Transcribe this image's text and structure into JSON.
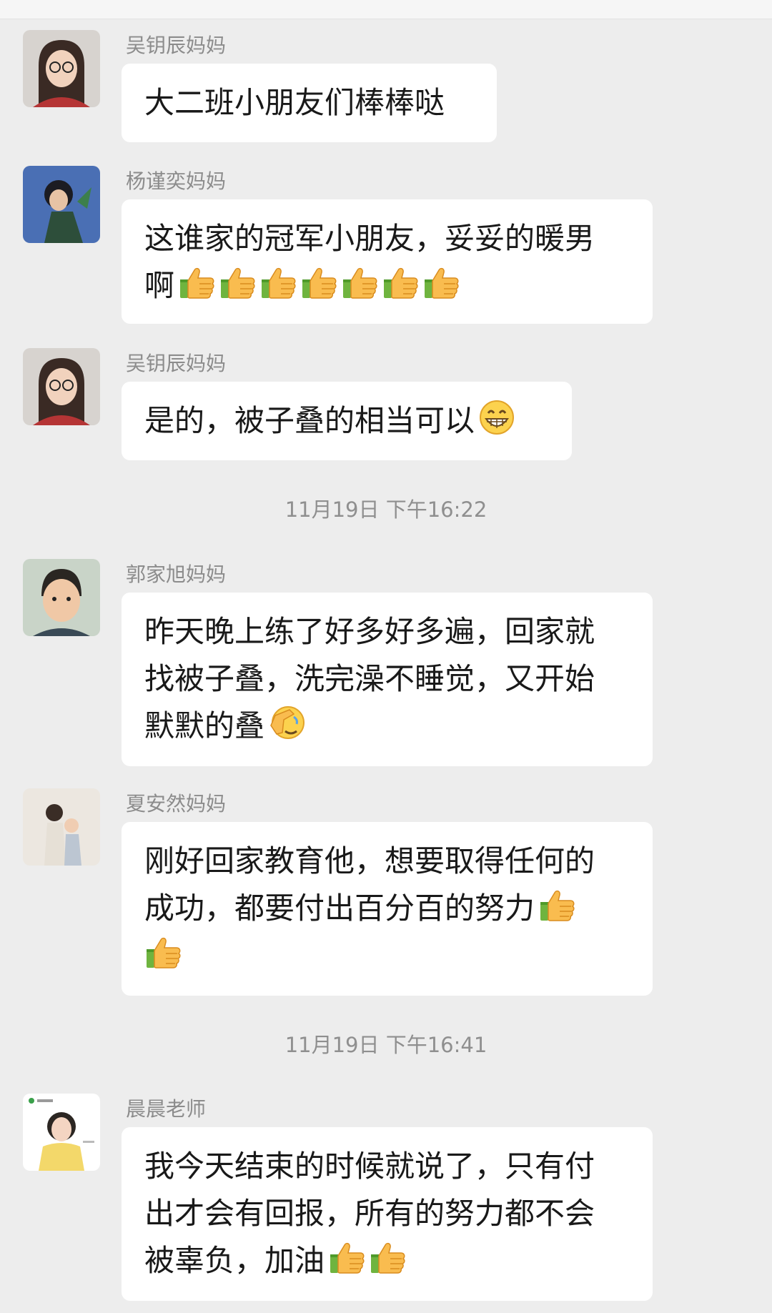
{
  "messages": [
    {
      "sender": "吴钥辰妈妈",
      "lines": [
        "大二班小朋友们棒棒哒"
      ]
    },
    {
      "sender": "杨谨奕妈妈",
      "lines": [
        "这谁家的冠军小朋友，妥妥的暖男",
        "啊"
      ]
    },
    {
      "sender": "吴钥辰妈妈",
      "lines": [
        "是的，被子叠的相当可以"
      ]
    },
    {
      "sender": "郭家旭妈妈",
      "lines": [
        "昨天晚上练了好多好多遍，回家就",
        "找被子叠，洗完澡不睡觉，又开始",
        "默默的叠"
      ]
    },
    {
      "sender": "夏安然妈妈",
      "lines": [
        "刚好回家教育他，想要取得任何的",
        "成功，都要付出百分百的努力",
        ""
      ]
    },
    {
      "sender": "晨晨老师",
      "lines": [
        "我今天结束的时候就说了，只有付",
        "出才会有回报，所有的努力都不会",
        "被辜负，加油"
      ]
    }
  ],
  "timestamps": [
    "11月19日 下午16:22",
    "11月19日 下午16:41"
  ],
  "icons": {
    "thumbs_up": "thumbs-up-emoji",
    "grin": "grin-emoji",
    "facepalm": "facepalm-emoji"
  },
  "colors": {
    "background": "#ededed",
    "bubble": "#ffffff",
    "sender_text": "#8c8c8c",
    "message_text": "#191919"
  }
}
